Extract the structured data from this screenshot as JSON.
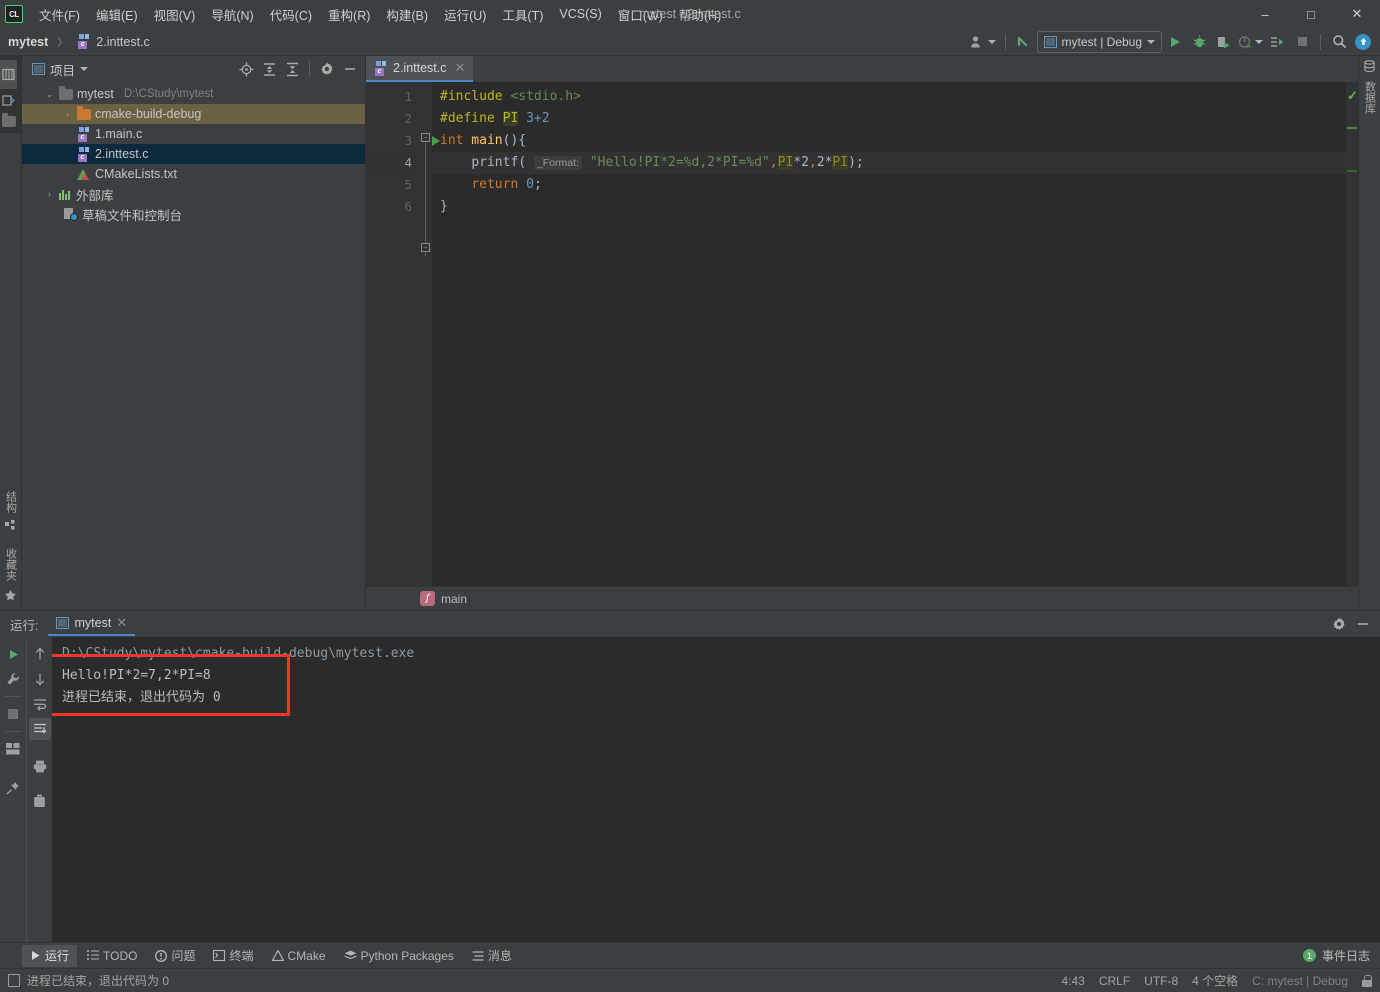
{
  "window": {
    "title": "mytest - 2.inttest.c",
    "minimize": "–",
    "maximize": "□",
    "close": "✕"
  },
  "menu": {
    "logo": "CL",
    "items": [
      "文件(F)",
      "编辑(E)",
      "视图(V)",
      "导航(N)",
      "代码(C)",
      "重构(R)",
      "构建(B)",
      "运行(U)",
      "工具(T)",
      "VCS(S)",
      "窗口(W)",
      "帮助(H)"
    ]
  },
  "navbar": {
    "project": "mytest",
    "separator": "〉",
    "file": "2.inttest.c",
    "run_config": "mytest | Debug",
    "buttons": [
      "profiler-icon",
      "vcs-update-icon",
      "run-icon",
      "debug-icon",
      "run-coverage-icon",
      "profile-icon",
      "attach-icon",
      "stop-icon",
      "search-everywhere-icon",
      "update-icon"
    ]
  },
  "left_strip": {
    "project_tab": "项目",
    "structure_tab": "结构",
    "favorites_tab": "收藏夹"
  },
  "right_strip": {
    "database_tab": "数据库"
  },
  "project_panel": {
    "title": "项目",
    "header_icons": [
      "locate-icon",
      "expand-all-icon",
      "collapse-all-icon",
      "settings-icon",
      "hide-icon"
    ],
    "tree": [
      {
        "label": "mytest",
        "path": "D:\\CStudy\\mytest",
        "indent": 0,
        "twisty": "⌄",
        "icon": "folder",
        "state": "normal"
      },
      {
        "label": "cmake-build-debug",
        "path": "",
        "indent": 1,
        "twisty": "›",
        "icon": "folder-orange",
        "state": "olive"
      },
      {
        "label": "1.main.c",
        "path": "",
        "indent": 2,
        "twisty": "",
        "icon": "c-file",
        "state": "normal"
      },
      {
        "label": "2.inttest.c",
        "path": "",
        "indent": 2,
        "twisty": "",
        "icon": "c-file",
        "state": "blue"
      },
      {
        "label": "CMakeLists.txt",
        "path": "",
        "indent": 2,
        "twisty": "",
        "icon": "cmake",
        "state": "normal"
      },
      {
        "label": "外部库",
        "path": "",
        "indent": 0,
        "twisty": "›",
        "icon": "library",
        "state": "normal"
      },
      {
        "label": "草稿文件和控制台",
        "path": "",
        "indent": 1,
        "twisty": "",
        "icon": "scratch",
        "state": "normal"
      }
    ]
  },
  "editor": {
    "tab": {
      "label": "2.inttest.c",
      "close": "✕"
    },
    "breadcrumb": {
      "badge": "f",
      "label": "main"
    },
    "line_numbers": [
      "1",
      "2",
      "3",
      "4",
      "5",
      "6"
    ],
    "current_line": 4,
    "code": {
      "l1_include": "#include",
      "l1_header": " <stdio.h>",
      "l2_define": "#define",
      "l2_pi": "PI",
      "l2_val": " 3+2",
      "l3_int": "int",
      "l3_main": " main",
      "l3_rest": "(){",
      "l4_printf": "printf",
      "l4_open": "( ",
      "l4_hint": "_Format:",
      "l4_str": " \"Hello!PI*2=%d,2*PI=%d\"",
      "l4_comma1": ",",
      "l4_pi1": "PI",
      "l4_mid": "*2",
      "l4_comma2": ",",
      "l4_two": "2*",
      "l4_pi2": "PI",
      "l4_end": ");",
      "l5_return": "return",
      "l5_zero": " 0",
      "l5_semi": ";",
      "l6_brace": "}"
    }
  },
  "run_panel": {
    "label": "运行:",
    "tab": "mytest",
    "tab_close": "✕",
    "header_icons": [
      "settings-icon",
      "hide-icon"
    ],
    "left_tools": [
      "rerun-icon",
      "wrench-icon",
      "stop-icon",
      "layout-icon",
      "pin-icon"
    ],
    "right_tools": [
      "up-arrow-icon",
      "down-arrow-icon",
      "soft-wrap-icon",
      "scroll-to-end-icon",
      "print-icon",
      "trash-icon"
    ],
    "console": {
      "command": "D:\\CStudy\\mytest\\cmake-build-debug\\mytest.exe",
      "output_1": "Hello!PI*2=7,2*PI=8",
      "output_2": "进程已结束，退出代码为 0"
    },
    "highlight_color": "#f3352b"
  },
  "bottom_bar": {
    "items": [
      {
        "label": "运行",
        "icon": "run-icon",
        "active": true
      },
      {
        "label": "TODO",
        "icon": "todo-icon",
        "active": false
      },
      {
        "label": "问题",
        "icon": "problems-icon",
        "active": false
      },
      {
        "label": "终端",
        "icon": "terminal-icon",
        "active": false
      },
      {
        "label": "CMake",
        "icon": "cmake-icon",
        "active": false
      },
      {
        "label": "Python Packages",
        "icon": "packages-icon",
        "active": false
      },
      {
        "label": "消息",
        "icon": "messages-icon",
        "active": false
      }
    ],
    "event_log": {
      "count": "1",
      "label": "事件日志"
    }
  },
  "status_bar": {
    "message": "进程已结束，退出代码为 0",
    "caret": "4:43",
    "line_sep": "CRLF",
    "encoding": "UTF-8",
    "indent": "4 个空格",
    "branch": "C: mytest | Debug",
    "lock": "lock-icon"
  },
  "colors": {
    "accent_blue": "#4a88c7",
    "green": "#62b543",
    "selection_blue": "#0d293e",
    "selection_olive": "#6b6243",
    "editor_bg": "#2b2b2b",
    "panel_bg": "#3c3f41",
    "highlight_red": "#f3352b"
  }
}
